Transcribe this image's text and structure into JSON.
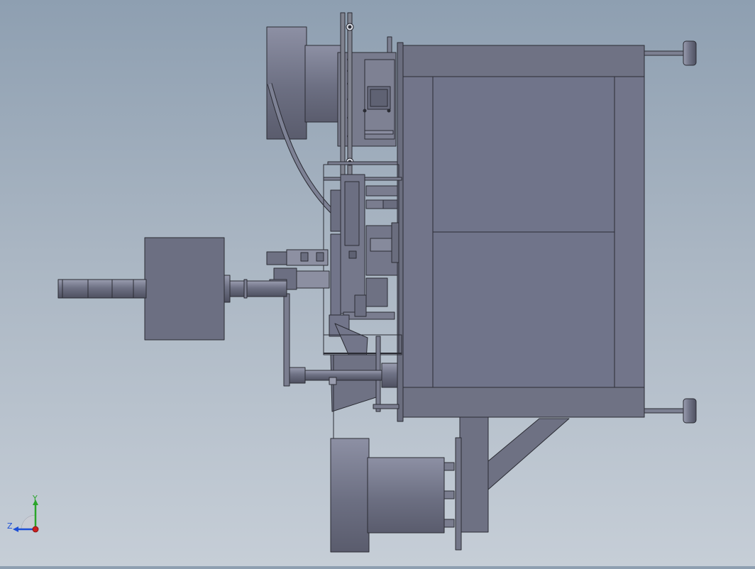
{
  "triad": {
    "y_label": "Y",
    "z_label": "Z",
    "colors": {
      "y_axis": "#2aa52a",
      "z_axis": "#1d4fd6",
      "x_axis": "#cc1f1f"
    }
  },
  "colors": {
    "metal_dark": "#686b7c",
    "metal_mid": "#73778a",
    "metal_light": "#8e92a3",
    "outline": "#2b2c34"
  }
}
